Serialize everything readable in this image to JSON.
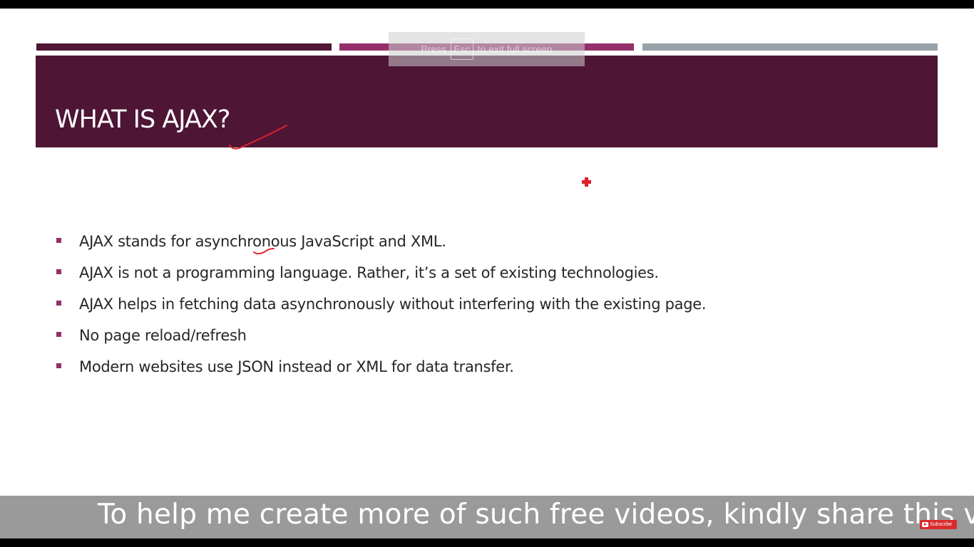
{
  "fullscreen_notice": {
    "press": "Press",
    "key": "Esc",
    "message": "to exit full screen"
  },
  "slide": {
    "title": "WHAT IS AJAX?",
    "bullets": [
      {
        "text": "AJAX stands for asynchronous JavaScript and XML."
      },
      {
        "text": "AJAX is not a programming language. Rather, it’s a set of existing technologies."
      },
      {
        "text": "AJAX helps in fetching data asynchronously without interfering with the existing page."
      },
      {
        "text": "No page reload/refresh"
      },
      {
        "text": "Modern websites use JSON instead or XML for data transfer."
      }
    ]
  },
  "caption": {
    "text": "To help me create more of such free videos, kindly share this video"
  },
  "subscribe_badge": {
    "label": "Subscribe"
  },
  "colors": {
    "title_band": "#4e1535",
    "stripe_1": "#4e1535",
    "stripe_2": "#93306a",
    "stripe_3": "#97a3a8",
    "bullet_marker": "#93306a",
    "annotation_ink": "#e0202a",
    "caption_bar": "#9a9a9a"
  },
  "icons": {
    "laser_pointer": "red-cross-pointer-icon",
    "subscribe": "youtube-play-icon"
  }
}
